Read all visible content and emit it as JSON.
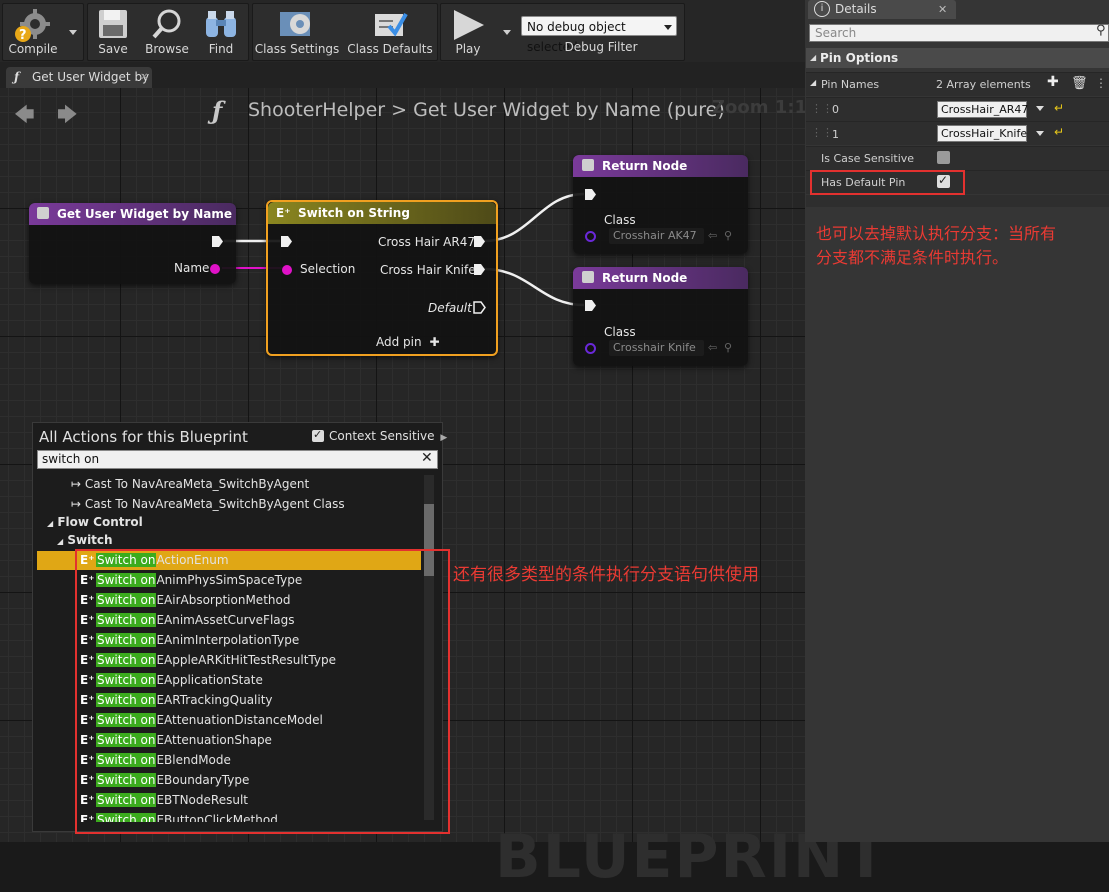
{
  "toolbar": {
    "compile": "Compile",
    "save": "Save",
    "browse": "Browse",
    "find": "Find",
    "class_settings": "Class Settings",
    "class_defaults": "Class Defaults",
    "play": "Play",
    "debug_select": "No debug object selected",
    "debug_filter": "Debug Filter"
  },
  "tab": {
    "label": "Get User Widget by"
  },
  "graph": {
    "breadcrumb_root": "ShooterHelper",
    "breadcrumb_sep": ">",
    "breadcrumb_func": "Get User Widget by Name (pure)",
    "zoom": "Zoom 1:1",
    "watermark": "BLUEPRINT"
  },
  "nodes": {
    "entry": {
      "title": "Get User Widget by Name",
      "pin_name": "Name"
    },
    "switch": {
      "title": "Switch on String",
      "selection": "Selection",
      "case1": "Cross Hair AR47",
      "case2": "Cross Hair Knife",
      "default": "Default",
      "add_pin": "Add pin"
    },
    "return1": {
      "title": "Return Node",
      "class_label": "Class",
      "class_value": "Crosshair AK47"
    },
    "return2": {
      "title": "Return Node",
      "class_label": "Class",
      "class_value": "Crosshair Knife"
    }
  },
  "actions": {
    "title": "All Actions for this Blueprint",
    "context_sensitive": "Context Sensitive",
    "search_value": "switch on",
    "items_top": [
      "Cast To NavAreaMeta_SwitchByAgent",
      "Cast To NavAreaMeta_SwitchByAgent Class"
    ],
    "category": "Flow Control",
    "subcategory": "Switch",
    "switch_prefix": "Switch on",
    "switch_items": [
      "ActionEnum",
      "AnimPhysSimSpaceType",
      "EAirAbsorptionMethod",
      "EAnimAssetCurveFlags",
      "EAnimInterpolationType",
      "EAppleARKitHitTestResultType",
      "EApplicationState",
      "EARTrackingQuality",
      "EAttenuationDistanceModel",
      "EAttenuationShape",
      "EBlendMode",
      "EBoundaryType",
      "EBTNodeResult",
      "EButtonClickMethod"
    ]
  },
  "details": {
    "tab_title": "Details",
    "search_placeholder": "Search",
    "section": "Pin Options",
    "pin_names_label": "Pin Names",
    "pin_names_count": "2 Array elements",
    "rows": [
      {
        "index": "0",
        "value": "CrossHair_AR47"
      },
      {
        "index": "1",
        "value": "CrossHair_Knife"
      }
    ],
    "case_sensitive_label": "Is Case Sensitive",
    "case_sensitive_checked": false,
    "has_default_label": "Has Default Pin",
    "has_default_checked": true
  },
  "annotations": {
    "right_note_line1": "也可以去掉默认执行分支：当所有",
    "right_note_line2": "分支都不满足条件时执行。",
    "list_note": "还有很多类型的条件执行分支语句供使用"
  },
  "colors": {
    "accent_red": "#e3312f",
    "pure_func_header": "#5e2a78",
    "switch_header": "#6d6a22",
    "selected_border": "#f0a020",
    "highlight_green": "#3bab1d",
    "selected_row": "#e0a715",
    "string_pin": "#e012c8",
    "class_pin": "#6a28d8"
  }
}
